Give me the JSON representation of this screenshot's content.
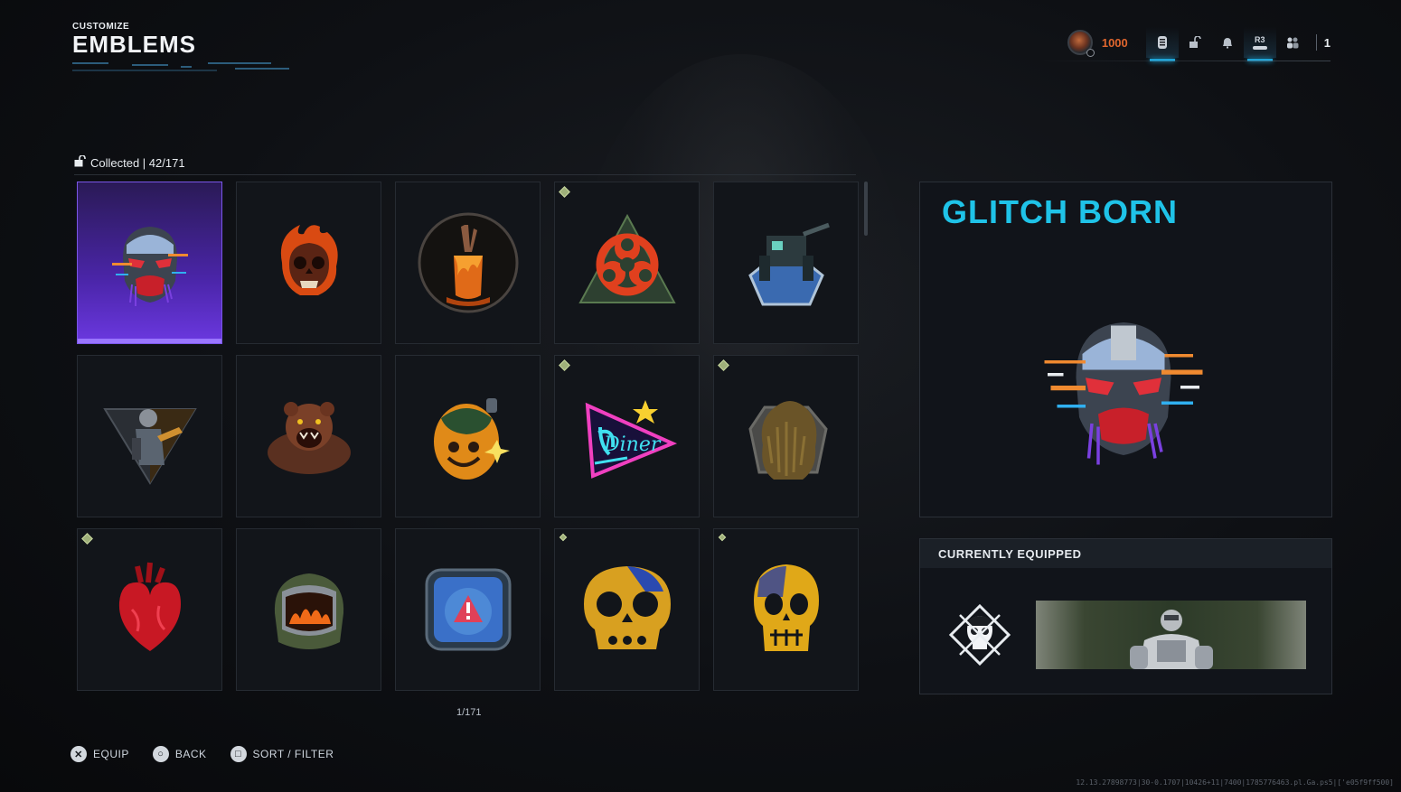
{
  "header": {
    "kicker": "CUSTOMIZE",
    "title": "EMBLEMS"
  },
  "topbar": {
    "points": "1000",
    "icons": [
      "trophy-icon",
      "lock-icon",
      "bell-icon",
      "r3-icon",
      "friends-icon"
    ],
    "r3_label": "R3",
    "friends_count": "1"
  },
  "collection": {
    "label": "Collected | 42/171"
  },
  "emblems": [
    {
      "icon": "glitch-mask",
      "selected": true,
      "new": false
    },
    {
      "icon": "flaming-skull",
      "new": false
    },
    {
      "icon": "melting-candle-hand",
      "new": false
    },
    {
      "icon": "biohazard-symbol",
      "new": true
    },
    {
      "icon": "mech-turret",
      "new": false
    },
    {
      "icon": "soldier-triangle",
      "new": false
    },
    {
      "icon": "roaring-bear",
      "new": false
    },
    {
      "icon": "smiley-grenade",
      "new": false
    },
    {
      "icon": "neon-diner-sign",
      "new": true
    },
    {
      "icon": "ghillie-creature",
      "new": true
    },
    {
      "icon": "anatomical-heart",
      "new": true
    },
    {
      "icon": "helmet-fire",
      "new": false
    },
    {
      "icon": "warning-screen",
      "new": false
    },
    {
      "icon": "gold-skull-outline",
      "new": true
    },
    {
      "icon": "gold-skull",
      "new": true
    }
  ],
  "pager": "1/171",
  "detail": {
    "name": "GLITCH BORN"
  },
  "equipped": {
    "heading": "CURRENTLY EQUIPPED",
    "emblem_icon": "pirate-skull-icon",
    "calling_card": "robot-calling-card"
  },
  "footer": [
    {
      "glyph": "✕",
      "label": "EQUIP"
    },
    {
      "glyph": "○",
      "label": "BACK"
    },
    {
      "glyph": "□",
      "label": "SORT / FILTER"
    }
  ],
  "debug": "12.13.27898773|30-0.1707|10426+11|7400|1785776463.pl.Ga.ps5|['e05f9ff500]"
}
